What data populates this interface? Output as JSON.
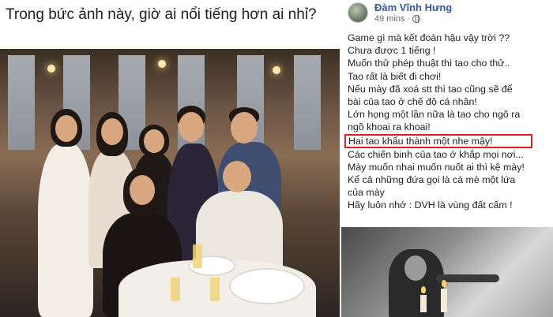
{
  "left_post": {
    "caption": "Trong bức ảnh này, giờ ai nổi tiếng hơn ai nhỉ?"
  },
  "right_post": {
    "author": "Đàm Vĩnh Hưng",
    "time": "49 mins",
    "separator": "·",
    "visibility_icon": "globe-icon",
    "lines": [
      "Game gì mà kết đoàn hậu vậy trời ??",
      "Chưa được 1 tiếng !",
      "Muốn thử phép thuật thì tao cho thử..",
      "Tao rất là biết đi chơi!",
      "Nếu mày đã xoá stt thì tao cũng sẽ để",
      "bài của tao ở chế độ cá nhân!",
      "Lớn họng một lần nữa là tao cho ngõ ra",
      "ngõ khoai ra khoai!",
      "Hai tao khẩu thành một nhe mậy!",
      "Các chiến binh của tao ở khắp mọi nơi...",
      "Mày muốn nhai muốn nuốt ai thì kệ mày!",
      "Kể cả những đứa gọi là cá mè một lứa",
      "của mày",
      "Hãy luôn nhớ : DVH  là vùng đất cấm !"
    ],
    "highlight_index": 8,
    "highlight_color": "#e02020",
    "author_color": "#385898"
  }
}
